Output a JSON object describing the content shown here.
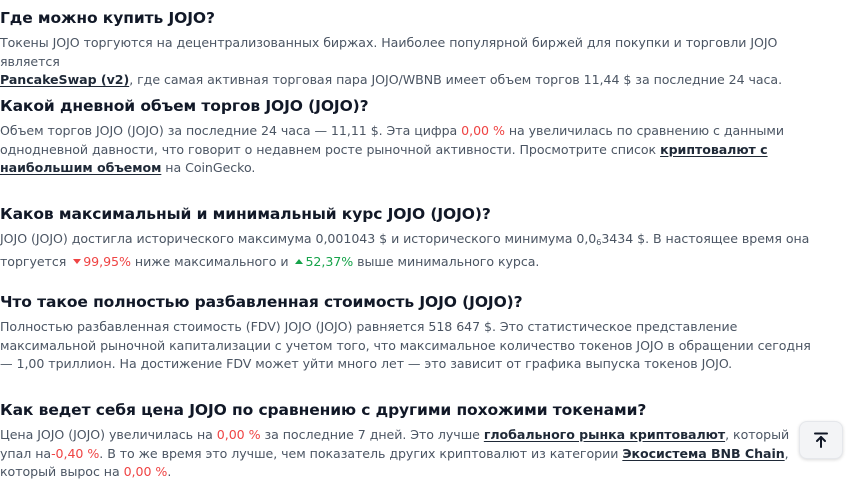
{
  "faq": [
    {
      "q": "Где можно купить JOJO?",
      "a_line1": "Токены JOJO торгуются на децентрализованных биржах. Наиболее популярной биржей для покупки и торговли JOJO является",
      "link": "PancakeSwap (v2)",
      "a_line2": ", где самая активная торговая пара JOJO/WBNB имеет объем торгов 11,44 $ за последние 24 часа."
    },
    {
      "q": "Какой дневной объем торгов JOJO (JOJO)?",
      "a_pre": "Объем торгов JOJO (JOJO) за последние 24 часа — 11,11 $. Эта цифра",
      "pct": "0,00 %",
      "a_mid": " на увеличилась по сравнению с данными однодневной давности, что говорит о недавнем росте рыночной активности. Просмотрите список",
      "link": "криптовалют с наибольшим объемом",
      "a_post": " на CoinGecko."
    },
    {
      "q": "Каков максимальный и минимальный курс JOJO (JOJO)?",
      "a_pre": "JOJO (JOJO) достигла исторического максимума 0,001043 $ и исторического минимума 0,0",
      "sub": "6",
      "a_mid": "3434 $. В настоящее время она торгуется",
      "down_pct": "99,95%",
      "a_mid2": " ниже максимального и",
      "up_pct": "52,37%",
      "a_post": " выше минимального курса."
    },
    {
      "q": "Что такое полностью разбавленная стоимость JOJO (JOJO)?",
      "a": "Полностью разбавленная стоимость (FDV) JOJO (JOJO) равняется 518 647 $. Это статистическое представление максимальной рыночной капитализации с учетом того, что максимальное количество токенов JOJO в обращении сегодня — 1,00 триллион. На достижение FDV может уйти много лет — это зависит от графика выпуска токенов JOJO."
    },
    {
      "q": "Как ведет себя цена JOJO по сравнению с другими похожими токенами?",
      "a_pre": "Цена JOJO (JOJO) увеличилась на",
      "pct1": "0,00 %",
      "a_mid": " за последние 7 дней. Это лучше",
      "link1": "глобального рынка криптовалют",
      "a_mid2": ", который упал на",
      "pct2": "-0,40 %",
      "a_mid3": ". В то же время это лучше, чем показатель других криптовалют из категории",
      "link2": "Экосистема BNB Chain",
      "a_mid4": ", который вырос на",
      "pct3": "0,00 %",
      "a_post": "."
    }
  ],
  "scroll_top_icon": "arrow-up-to-line-icon"
}
